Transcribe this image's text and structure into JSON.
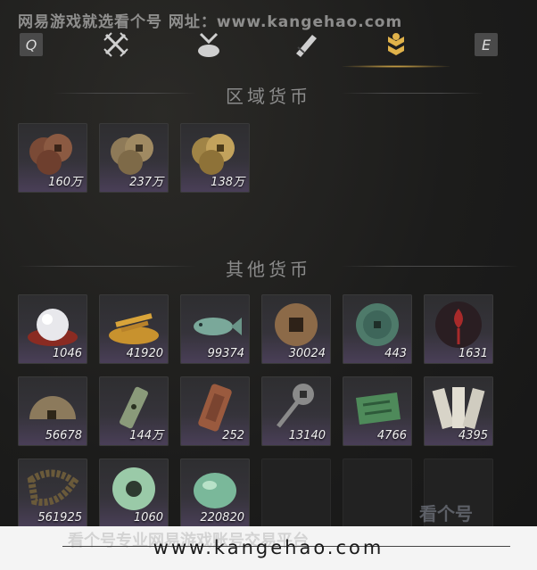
{
  "watermark": "网易游戏就选看个号  网址：www.kangehao.com",
  "tabs": {
    "left_key": "Q",
    "right_key": "E",
    "items": [
      {
        "icon": "crossed-swords-icon"
      },
      {
        "icon": "pouch-icon"
      },
      {
        "icon": "scroll-icon"
      },
      {
        "icon": "currency-icon",
        "active": true
      }
    ]
  },
  "regional": {
    "title": "区域货币",
    "items": [
      {
        "icon": "copper-coins-icon",
        "amount": "160万"
      },
      {
        "icon": "bronze-coins-icon",
        "amount": "237万"
      },
      {
        "icon": "gold-coins-icon",
        "amount": "138万"
      }
    ]
  },
  "other": {
    "title": "其他货币",
    "items": [
      {
        "icon": "pearl-icon",
        "amount": "1046"
      },
      {
        "icon": "grain-icon",
        "amount": "41920"
      },
      {
        "icon": "fish-icon",
        "amount": "99374"
      },
      {
        "icon": "square-hole-coin-icon",
        "amount": "30024"
      },
      {
        "icon": "jade-coin-icon",
        "amount": "443"
      },
      {
        "icon": "red-ornament-icon",
        "amount": "1631"
      },
      {
        "icon": "half-coin-icon",
        "amount": "56678"
      },
      {
        "icon": "token-icon",
        "amount": "144万"
      },
      {
        "icon": "copper-plaque-icon",
        "amount": "252"
      },
      {
        "icon": "key-coin-icon",
        "amount": "13140"
      },
      {
        "icon": "green-cloth-icon",
        "amount": "4766"
      },
      {
        "icon": "paper-slips-icon",
        "amount": "4395"
      },
      {
        "icon": "coin-string-icon",
        "amount": "561925"
      },
      {
        "icon": "jade-bi-icon",
        "amount": "1060"
      },
      {
        "icon": "jade-pendant-icon",
        "amount": "220820"
      },
      {
        "icon": "",
        "amount": ""
      },
      {
        "icon": "",
        "amount": ""
      },
      {
        "icon": "",
        "amount": ""
      }
    ]
  },
  "footer": {
    "url": "www.kangehao.com",
    "ghost_text": "看个号专业网易游戏账号交易平台",
    "logo": "看个号"
  }
}
